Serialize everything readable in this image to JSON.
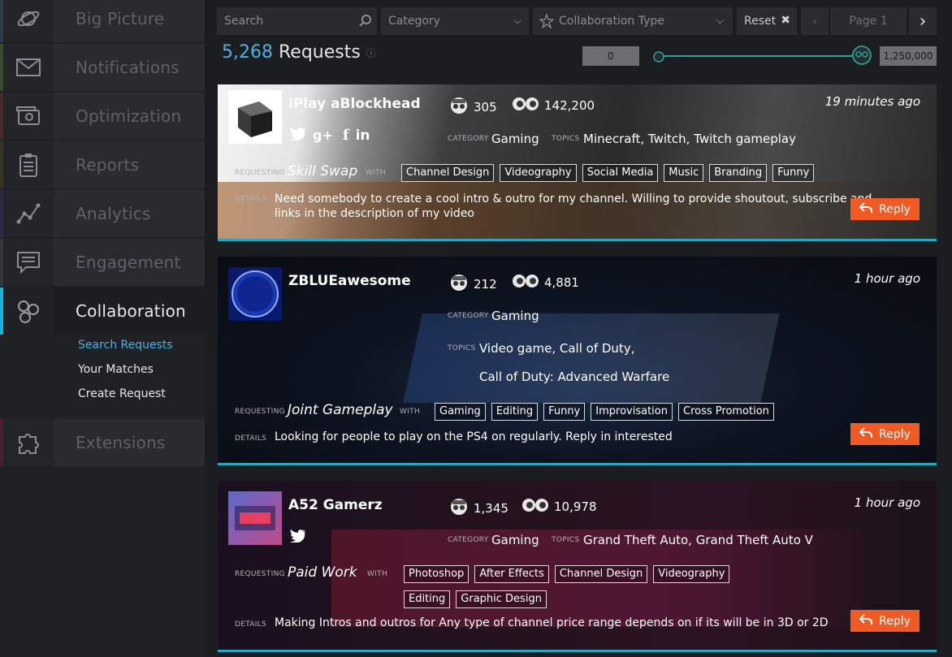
{
  "sidebar": {
    "items": [
      {
        "label": "Big Picture",
        "icon": "planet-icon",
        "stripe": "#2c3a4d"
      },
      {
        "label": "Notifications",
        "icon": "envelope-icon",
        "stripe": "#3b4a2a"
      },
      {
        "label": "Optimization",
        "icon": "camera-icon",
        "stripe": "#4a2a2a"
      },
      {
        "label": "Reports",
        "icon": "clipboard-icon",
        "stripe": "#3a3520"
      },
      {
        "label": "Analytics",
        "icon": "analytics-icon",
        "stripe": "#2d2a45"
      },
      {
        "label": "Engagement",
        "icon": "chat-icon",
        "stripe": "#34363a"
      },
      {
        "label": "Collaboration",
        "icon": "collaboration-icon",
        "stripe": "#18b4e0"
      },
      {
        "label": "Extensions",
        "icon": "puzzle-icon",
        "stripe": "#4a2030"
      }
    ],
    "subnav": [
      "Search Requests",
      "Your Matches",
      "Create Request"
    ]
  },
  "topbar": {
    "search_placeholder": "Search",
    "category": "Category",
    "collab_type": "Collaboration Type",
    "reset": "Reset",
    "page": "Page 1"
  },
  "summary": {
    "count": "5,268",
    "label": "Requests",
    "range_min": "0",
    "range_max": "1,250,000"
  },
  "labels": {
    "category": "CATEGORY",
    "topics": "TOPICS",
    "requesting": "REQUESTING",
    "with": "WITH",
    "details": "DETAILS",
    "reply": "Reply"
  },
  "cards": [
    {
      "name": "iPlay aBlockhead",
      "subscribers": "305",
      "views": "142,200",
      "time": "19 minutes ago",
      "category": "Gaming",
      "topics": "Minecraft, Twitch, Twitch gameplay",
      "requesting": "Skill Swap",
      "tags": [
        "Channel Design",
        "Videography",
        "Social Media",
        "Music",
        "Branding",
        "Funny"
      ],
      "details_line1": "Need somebody to create a cool intro & outro for my channel. Willing to provide shoutout, subscribe and",
      "details_line2": "links in the description of my video"
    },
    {
      "name": "ZBLUEawesome",
      "subscribers": "212",
      "views": "4,881",
      "time": "1 hour ago",
      "category": "Gaming",
      "topics_line1": "Video game, Call of Duty,",
      "topics_line2": "Call of Duty: Advanced Warfare",
      "requesting": "Joint Gameplay",
      "tags": [
        "Gaming",
        "Editing",
        "Funny",
        "Improvisation",
        "Cross Promotion"
      ],
      "details": "Looking for people to play on the PS4 on regularly. Reply in interested"
    },
    {
      "name": "A52 Gamerz",
      "subscribers": "1,345",
      "views": "10,978",
      "time": "1 hour ago",
      "category": "Gaming",
      "topics": "Grand Theft Auto, Grand Theft Auto V",
      "requesting": "Paid Work",
      "tags": [
        "Photoshop",
        "After Effects",
        "Channel Design",
        "Videography",
        "Editing",
        "Graphic Design"
      ],
      "details": "Making Intros and outros for Any type of channel price range depends on if its will be in 3D or 2D"
    }
  ],
  "colors": {
    "accent": "#4fb0e3",
    "reply": "#f05a24",
    "divider": "#2aa6bf"
  }
}
